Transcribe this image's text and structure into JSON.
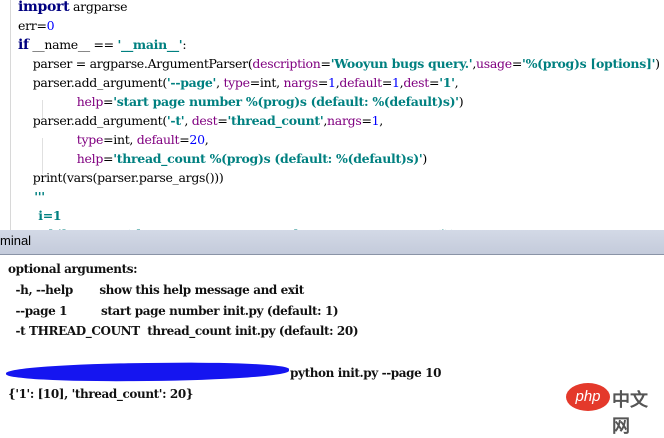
{
  "editor": {
    "lines": [
      [
        [
          "import",
          "kw"
        ],
        [
          " argparse",
          "plain"
        ]
      ],
      [
        [
          "err=",
          "plain"
        ],
        [
          "0",
          "num"
        ]
      ],
      [
        [
          "if",
          "kw"
        ],
        [
          " __name__ == ",
          "plain"
        ],
        [
          "'__main__'",
          "str"
        ],
        [
          ":",
          "plain"
        ]
      ],
      [
        [
          "    parser = argparse.ArgumentParser(",
          "plain"
        ],
        [
          "description",
          "kwarg"
        ],
        [
          "=",
          "plain"
        ],
        [
          "'Wooyun bugs query.'",
          "str"
        ],
        [
          ",",
          "plain"
        ],
        [
          "usage",
          "kwarg"
        ],
        [
          "=",
          "plain"
        ],
        [
          "'%(prog)s [options]'",
          "str"
        ],
        [
          ")",
          "plain"
        ]
      ],
      [
        [
          "    parser.add_argument(",
          "plain"
        ],
        [
          "'--page'",
          "str"
        ],
        [
          ", ",
          "plain"
        ],
        [
          "type",
          "kwarg"
        ],
        [
          "=int, ",
          "plain"
        ],
        [
          "nargs",
          "kwarg"
        ],
        [
          "=",
          "plain"
        ],
        [
          "1",
          "num"
        ],
        [
          ",",
          "plain"
        ],
        [
          "default",
          "kwarg"
        ],
        [
          "=",
          "plain"
        ],
        [
          "1",
          "num"
        ],
        [
          ",",
          "plain"
        ],
        [
          "dest",
          "kwarg"
        ],
        [
          "=",
          "plain"
        ],
        [
          "'1'",
          "str"
        ],
        [
          ",",
          "plain"
        ]
      ],
      [
        [
          "                ",
          "plain"
        ],
        [
          "help",
          "kwarg"
        ],
        [
          "=",
          "plain"
        ],
        [
          "'start page number %(prog)s (default: %(default)s)'",
          "str"
        ],
        [
          ")",
          "plain"
        ]
      ],
      [
        [
          "    parser.add_argument(",
          "plain"
        ],
        [
          "'-t'",
          "str"
        ],
        [
          ", ",
          "plain"
        ],
        [
          "dest",
          "kwarg"
        ],
        [
          "=",
          "plain"
        ],
        [
          "'thread_count'",
          "str"
        ],
        [
          ",",
          "plain"
        ],
        [
          "nargs",
          "kwarg"
        ],
        [
          "=",
          "plain"
        ],
        [
          "1",
          "num"
        ],
        [
          ",",
          "plain"
        ]
      ],
      [
        [
          "                ",
          "plain"
        ],
        [
          "type",
          "kwarg"
        ],
        [
          "=int, ",
          "plain"
        ],
        [
          "default",
          "kwarg"
        ],
        [
          "=",
          "plain"
        ],
        [
          "20",
          "num"
        ],
        [
          ",",
          "plain"
        ]
      ],
      [
        [
          "                ",
          "plain"
        ],
        [
          "help",
          "kwarg"
        ],
        [
          "=",
          "plain"
        ],
        [
          "'thread_count %(prog)s (default: %(default)s)'",
          "str"
        ],
        [
          ")",
          "plain"
        ]
      ],
      [
        [
          "    print(vars(parser.parse_args()))",
          "plain"
        ]
      ],
      [
        [
          "    '''",
          "str"
        ]
      ],
      [
        [
          "     i=1",
          "str"
        ]
      ],
      [
        [
          "     while  page<(\"http://www.wooyun.org/bugs/new_page/\"+str(i))",
          "str"
        ]
      ]
    ]
  },
  "terminal": {
    "title": "minal",
    "lines": [
      "optional arguments:",
      "  -h, --help       show this help message and exit",
      "  --page 1         start page number init.py (default: 1)",
      "  -t THREAD_COUNT  thread_count init.py (default: 20)",
      "python init.py --page 10",
      "{'1': [10], 'thread_count': 20}"
    ]
  },
  "watermark": {
    "badge": "php",
    "text": "中文网"
  }
}
